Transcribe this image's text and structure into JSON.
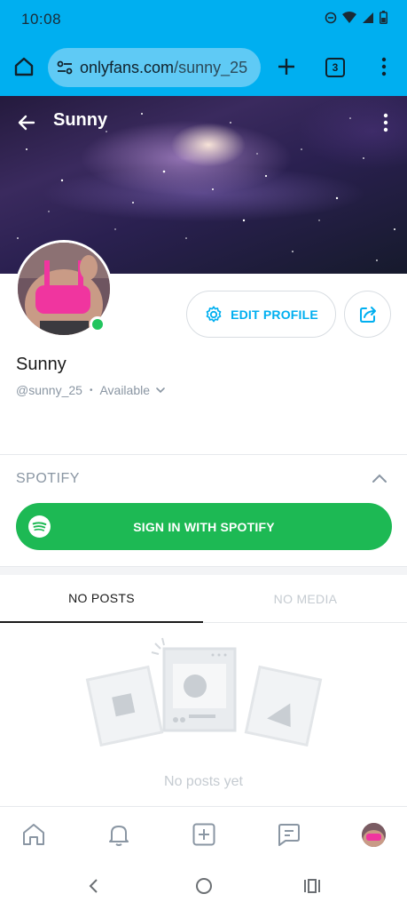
{
  "status_bar": {
    "time": "10:08"
  },
  "browser": {
    "url_domain": "onlyfans.com",
    "url_path": "/sunny_25",
    "tab_count": "3"
  },
  "cover": {
    "title": "Sunny"
  },
  "profile": {
    "name": "Sunny",
    "handle": "@sunny_25",
    "separator": "•",
    "availability": "Available",
    "edit_label": "EDIT PROFILE",
    "online": true
  },
  "spotify": {
    "section_title": "SPOTIFY",
    "sign_in_label": "SIGN IN WITH SPOTIFY"
  },
  "tabs": [
    {
      "label": "NO POSTS",
      "active": true
    },
    {
      "label": "NO MEDIA",
      "active": false
    }
  ],
  "empty_state": {
    "text": "No posts yet"
  },
  "colors": {
    "accent": "#00aff0",
    "spotify_green": "#1db954",
    "online_green": "#22c55e",
    "muted": "#8a96a3"
  },
  "icons": {
    "browser": [
      "home-icon",
      "site-settings-icon",
      "plus-icon",
      "tab-switcher-icon",
      "more-vert-icon"
    ],
    "bottom_nav": [
      "home-icon",
      "bell-icon",
      "add-post-icon",
      "messages-icon",
      "profile-avatar"
    ],
    "android_nav": [
      "back-icon",
      "home-circle-icon",
      "recents-icon"
    ]
  }
}
